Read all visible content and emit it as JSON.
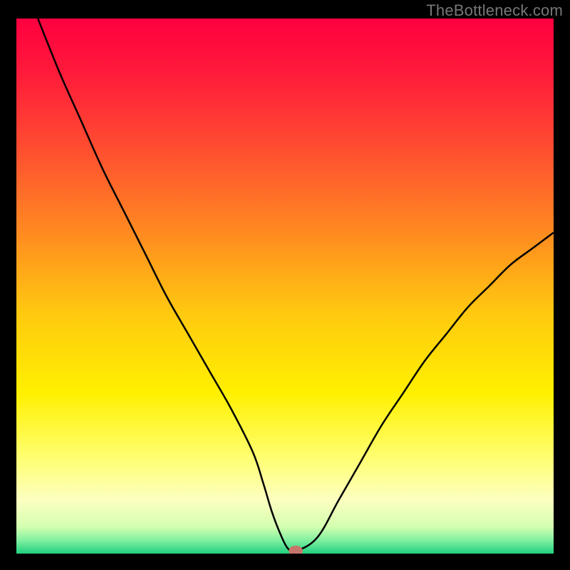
{
  "watermark": "TheBottleneck.com",
  "chart_data": {
    "type": "line",
    "title": "",
    "xlabel": "",
    "ylabel": "",
    "xlim": [
      0,
      100
    ],
    "ylim": [
      0,
      100
    ],
    "grid": false,
    "legend": false,
    "background_gradient": {
      "type": "vertical",
      "stops": [
        {
          "pos": 0.0,
          "color": "#ff0040"
        },
        {
          "pos": 0.1,
          "color": "#ff1a3a"
        },
        {
          "pos": 0.25,
          "color": "#ff5030"
        },
        {
          "pos": 0.4,
          "color": "#ff8a20"
        },
        {
          "pos": 0.55,
          "color": "#ffc910"
        },
        {
          "pos": 0.7,
          "color": "#fff000"
        },
        {
          "pos": 0.82,
          "color": "#ffff70"
        },
        {
          "pos": 0.9,
          "color": "#fcffc0"
        },
        {
          "pos": 0.95,
          "color": "#d4ffb0"
        },
        {
          "pos": 0.975,
          "color": "#80f0a0"
        },
        {
          "pos": 1.0,
          "color": "#20d080"
        }
      ]
    },
    "series": [
      {
        "name": "bottleneck-curve",
        "color": "#000000",
        "x": [
          4,
          8,
          12,
          16,
          20,
          24,
          28,
          32,
          36,
          40,
          44,
          46,
          47.5,
          49,
          50.5,
          52,
          56,
          60,
          64,
          68,
          72,
          76,
          80,
          84,
          88,
          92,
          96,
          100
        ],
        "y": [
          100,
          90,
          81,
          72,
          64,
          56,
          48,
          41,
          34,
          27,
          19,
          13,
          8,
          4,
          1,
          0.5,
          3,
          10,
          17,
          24,
          30,
          36,
          41,
          46,
          50,
          54,
          57,
          60
        ]
      }
    ],
    "marker": {
      "name": "optimal-point",
      "x": 52,
      "y": 0.5,
      "color": "#c7756a",
      "rx": 1.3,
      "ry": 1.0
    }
  }
}
